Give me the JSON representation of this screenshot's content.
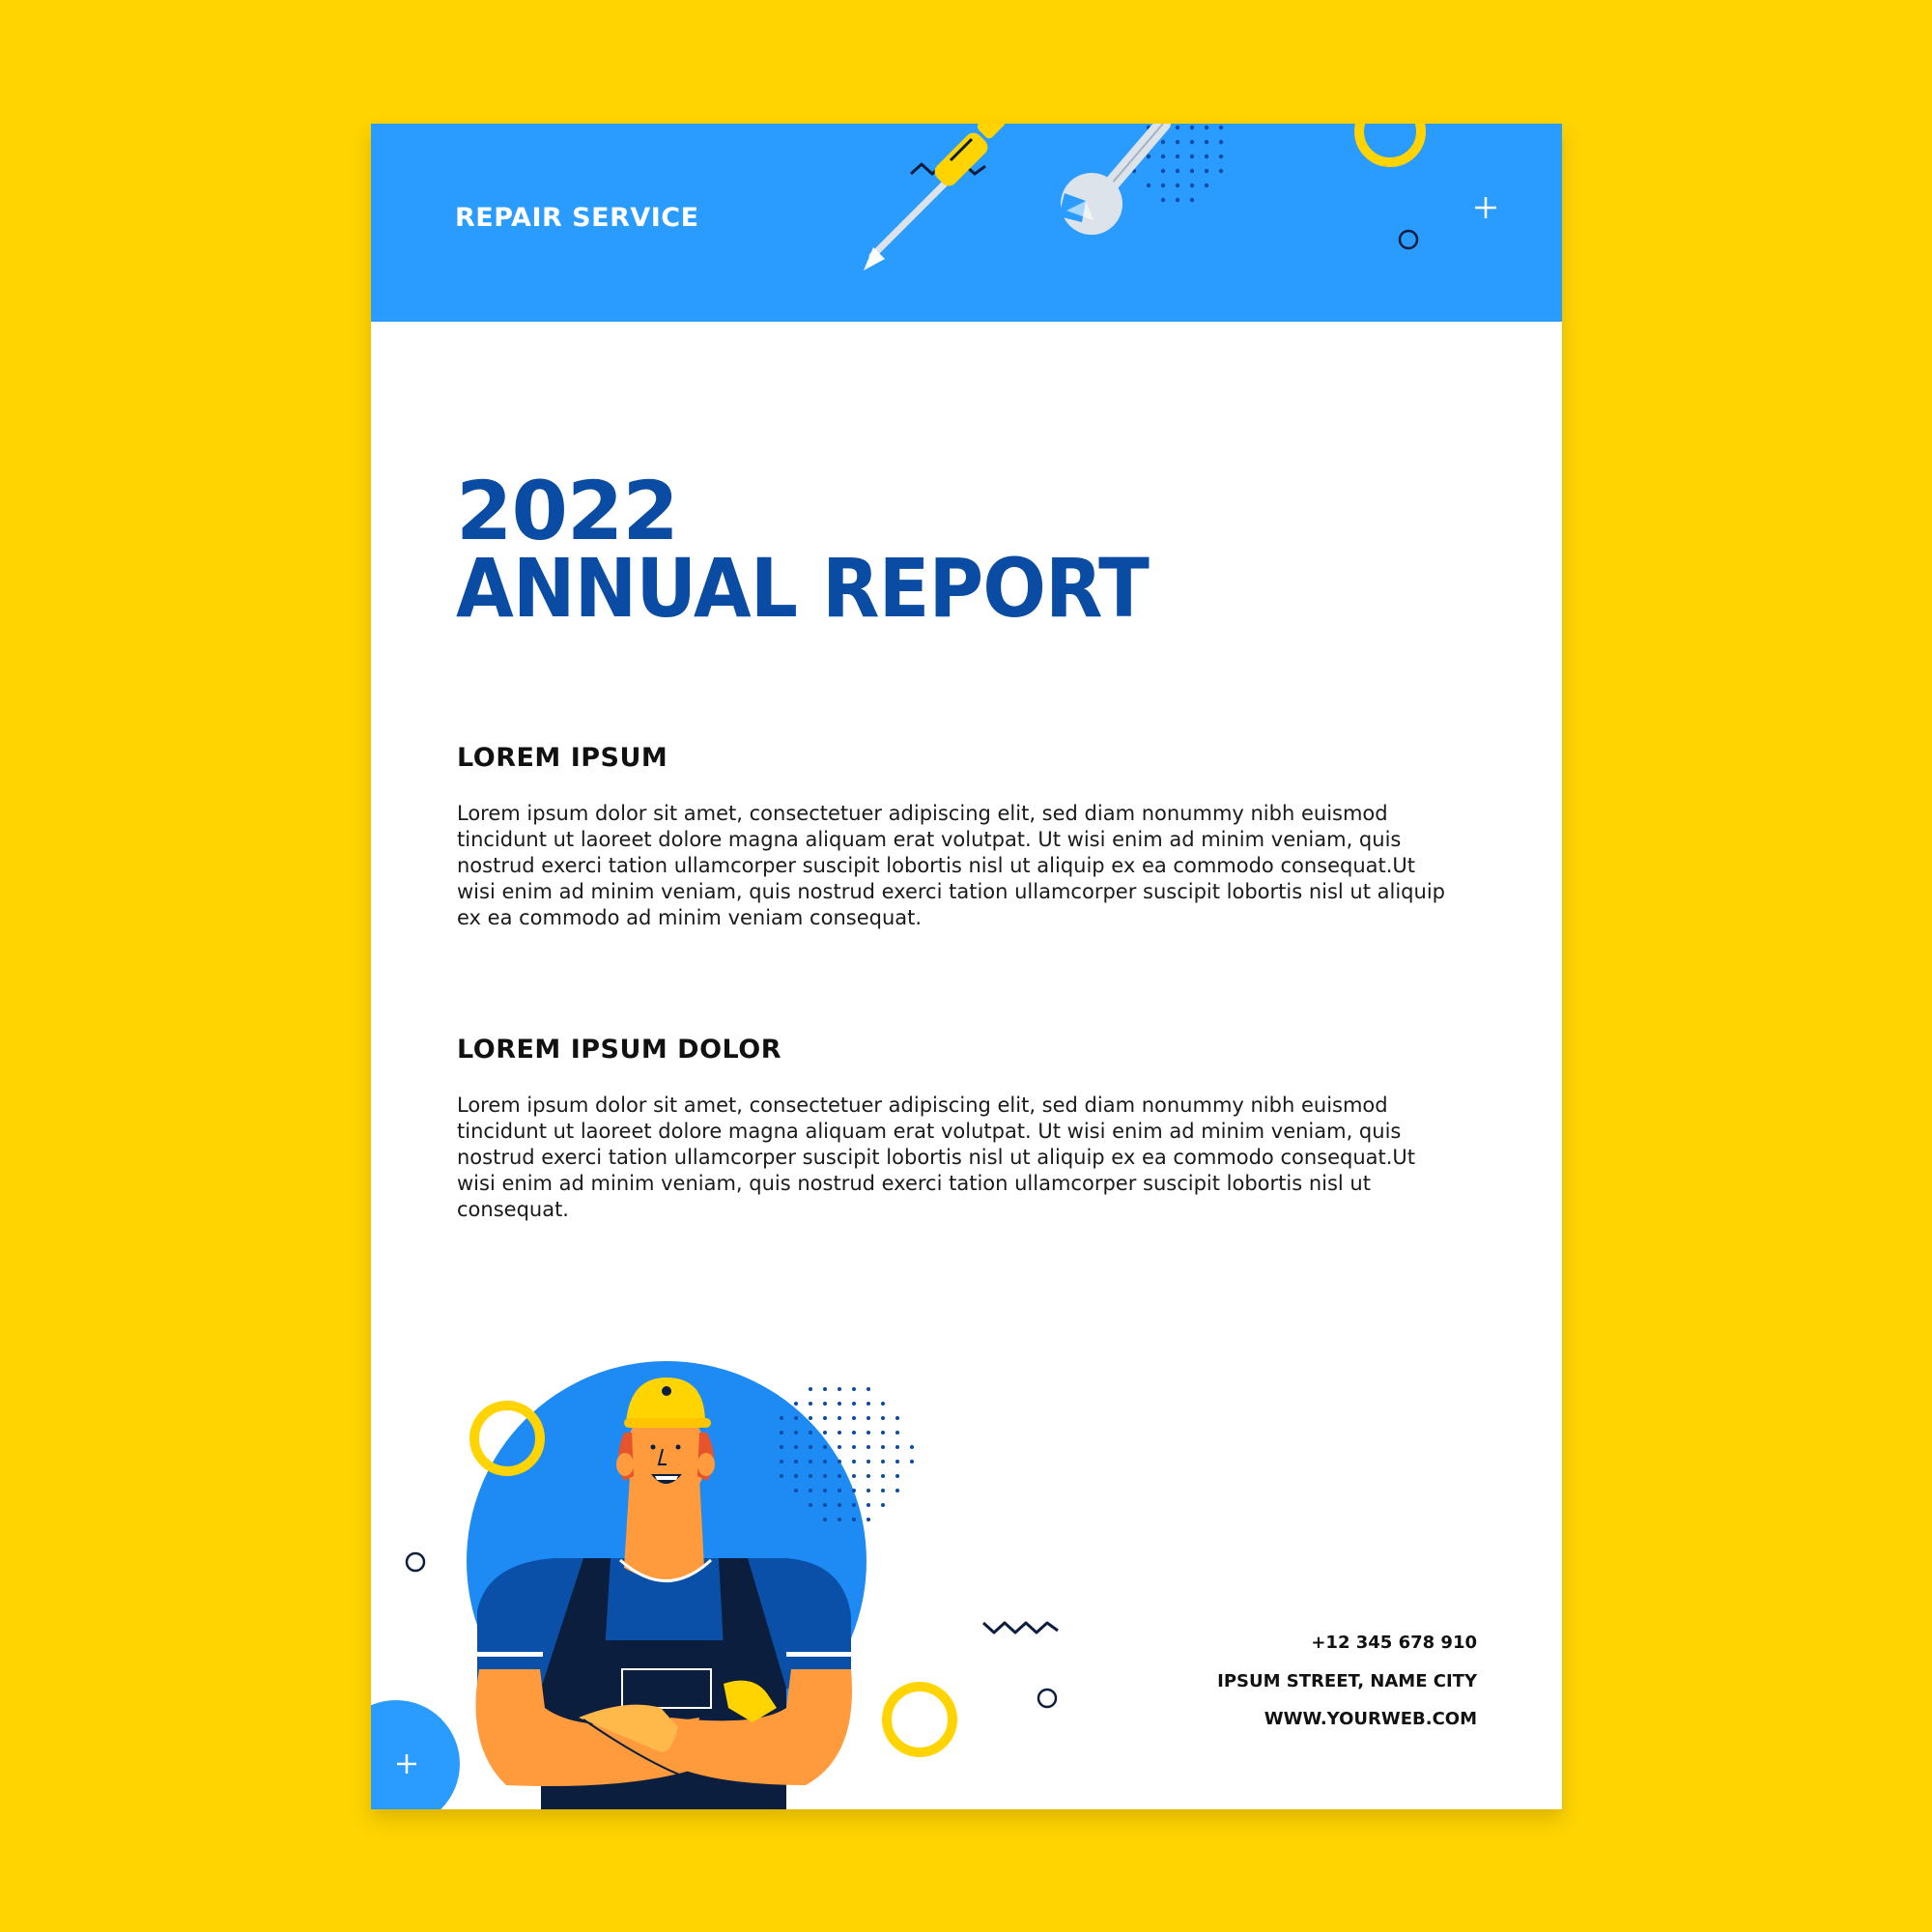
{
  "brand": {
    "name": "REPAIR SERVICE"
  },
  "title": {
    "year": "2022",
    "main": "ANNUAL REPORT"
  },
  "sections": [
    {
      "heading": "LOREM IPSUM",
      "body": "Lorem ipsum dolor sit amet, consectetuer adipiscing elit, sed diam nonummy nibh euismod tincidunt ut laoreet dolore magna aliquam erat volutpat. Ut wisi enim ad minim veniam, quis nostrud exerci tation ullamcorper suscipit lobortis nisl ut aliquip ex ea commodo consequat.Ut wisi enim ad minim veniam, quis nostrud exerci tation ullamcorper suscipit lobortis nisl ut aliquip ex ea commodo ad minim veniam consequat."
    },
    {
      "heading": "LOREM IPSUM DOLOR",
      "body": "Lorem ipsum dolor sit amet, consectetuer adipiscing elit, sed diam nonummy nibh euismod tincidunt ut laoreet dolore magna aliquam erat volutpat. Ut wisi enim ad minim veniam, quis nostrud exerci tation ullamcorper suscipit lobortis nisl ut aliquip ex ea commodo consequat.Ut wisi enim ad minim veniam, quis nostrud exerci tation ullamcorper suscipit lobortis nisl ut  consequat."
    }
  ],
  "contact": {
    "phone": "+12 345 678 910",
    "address": "IPSUM STREET, NAME CITY",
    "website": "WWW.YOURWEB.COM"
  },
  "icons": {
    "header": [
      "screwdriver-icon",
      "wrench-icon",
      "zigzag-icon",
      "plus-icon",
      "ring-icon"
    ],
    "footer": [
      "repairman-illustration",
      "ring-icon",
      "zigzag-icon",
      "plus-icon"
    ]
  },
  "colors": {
    "background": "#FFD400",
    "header_band": "#2A9BFF",
    "title": "#0A4BA3",
    "accent_yellow": "#FFD400",
    "worker_shirt": "#0A50A8",
    "worker_skin": "#FF9A3D"
  }
}
